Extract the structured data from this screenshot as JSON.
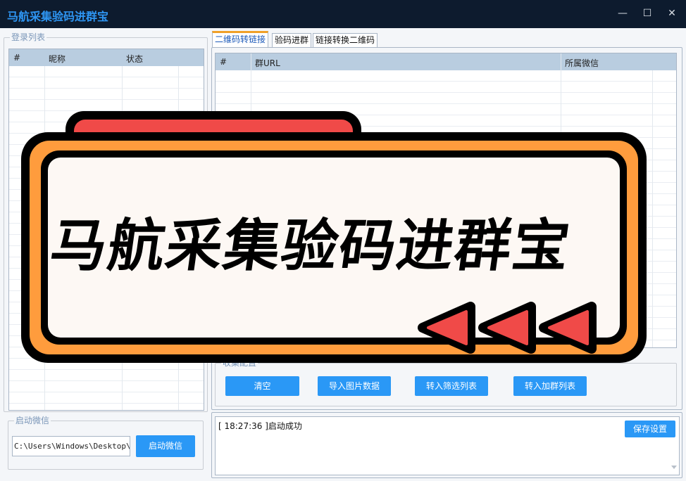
{
  "window": {
    "title": "马航采集验码进群宝",
    "controls": {
      "minimize": "—",
      "maximize": "☐",
      "close": "✕"
    }
  },
  "login_list": {
    "label": "登录列表",
    "columns": [
      "#",
      "昵称",
      "状态"
    ]
  },
  "start_wechat": {
    "label": "启动微信",
    "path_value": "C:\\Users\\Windows\\Desktop\\马航",
    "button_label": "启动微信"
  },
  "tabs": [
    "二维码转链接",
    "验码进群",
    "链接转换二维码"
  ],
  "group_table": {
    "columns": [
      "#",
      "群URL",
      "所属微信"
    ]
  },
  "collect_config": {
    "label": "收集配置",
    "buttons": [
      "清空",
      "导入图片数据",
      "转入筛选列表",
      "转入加群列表"
    ]
  },
  "log": {
    "entry": "[ 18:27:36 ]启动成功",
    "save_button": "保存设置"
  },
  "banner": {
    "text": "马航采集验码进群宝"
  },
  "colors": {
    "titlebar_bg": "#0d1b2e",
    "title_text": "#2e95f2",
    "button_blue": "#2a98f6",
    "banner_orange": "#ff9c3d",
    "banner_red": "#f04a48",
    "banner_fill": "#fdf8f4"
  }
}
